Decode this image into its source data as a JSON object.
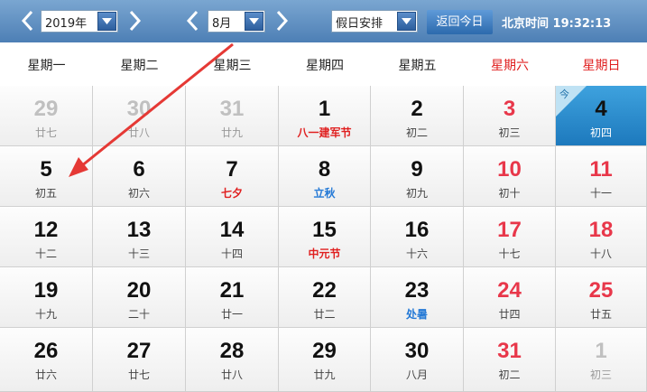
{
  "toolbar": {
    "year_value": "2019年",
    "month_value": "8月",
    "holiday_value": "假日安排",
    "today_label": "返回今日",
    "clock_label": "北京时间",
    "clock_time": "19:32:13"
  },
  "week_headers": [
    "星期一",
    "星期二",
    "星期三",
    "星期四",
    "星期五",
    "星期六",
    "星期日"
  ],
  "weeks": [
    [
      {
        "day": "29",
        "lunar": "廿七",
        "other": true
      },
      {
        "day": "30",
        "lunar": "廿八",
        "other": true
      },
      {
        "day": "31",
        "lunar": "廿九",
        "other": true
      },
      {
        "day": "1",
        "lunar": "八一建军节",
        "lunar_type": "festival"
      },
      {
        "day": "2",
        "lunar": "初二"
      },
      {
        "day": "3",
        "lunar": "初三",
        "red": true
      },
      {
        "day": "4",
        "lunar": "初四",
        "today": true,
        "today_tag": "今"
      }
    ],
    [
      {
        "day": "5",
        "lunar": "初五"
      },
      {
        "day": "6",
        "lunar": "初六"
      },
      {
        "day": "7",
        "lunar": "七夕",
        "lunar_type": "festival"
      },
      {
        "day": "8",
        "lunar": "立秋",
        "lunar_type": "term"
      },
      {
        "day": "9",
        "lunar": "初九"
      },
      {
        "day": "10",
        "lunar": "初十",
        "red": true
      },
      {
        "day": "11",
        "lunar": "十一",
        "red": true
      }
    ],
    [
      {
        "day": "12",
        "lunar": "十二"
      },
      {
        "day": "13",
        "lunar": "十三"
      },
      {
        "day": "14",
        "lunar": "十四"
      },
      {
        "day": "15",
        "lunar": "中元节",
        "lunar_type": "festival"
      },
      {
        "day": "16",
        "lunar": "十六"
      },
      {
        "day": "17",
        "lunar": "十七",
        "red": true
      },
      {
        "day": "18",
        "lunar": "十八",
        "red": true
      }
    ],
    [
      {
        "day": "19",
        "lunar": "十九"
      },
      {
        "day": "20",
        "lunar": "二十"
      },
      {
        "day": "21",
        "lunar": "廿一"
      },
      {
        "day": "22",
        "lunar": "廿二"
      },
      {
        "day": "23",
        "lunar": "处暑",
        "lunar_type": "term"
      },
      {
        "day": "24",
        "lunar": "廿四",
        "red": true
      },
      {
        "day": "25",
        "lunar": "廿五",
        "red": true
      }
    ],
    [
      {
        "day": "26",
        "lunar": "廿六"
      },
      {
        "day": "27",
        "lunar": "廿七"
      },
      {
        "day": "28",
        "lunar": "廿八"
      },
      {
        "day": "29",
        "lunar": "廿九"
      },
      {
        "day": "30",
        "lunar": "八月"
      },
      {
        "day": "31",
        "lunar": "初二",
        "red": true
      },
      {
        "day": "1",
        "lunar": "初三",
        "other": true
      }
    ]
  ],
  "colors": {
    "weekend_red": "#e8374a",
    "festival_red": "#e02020",
    "term_blue": "#2479d6",
    "today_blue": "#2a8fd2",
    "annotation_arrow": "#e53935"
  }
}
